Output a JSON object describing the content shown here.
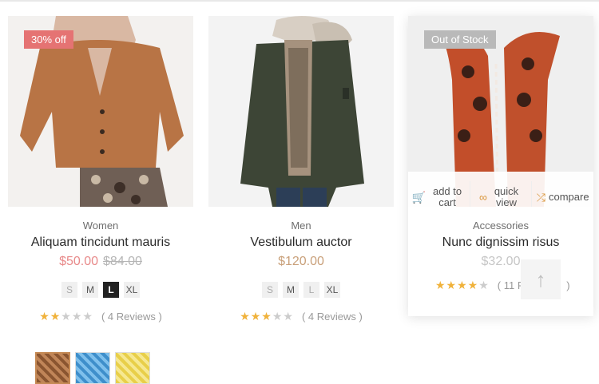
{
  "products": [
    {
      "badge": "30% off",
      "category": "Women",
      "name": "Aliquam tincidunt mauris",
      "price": "$50.00",
      "old_price": "$84.00",
      "sizes": [
        "S",
        "M",
        "L",
        "XL"
      ],
      "selected_size": "L",
      "rating": 2,
      "reviews": "( 4 Reviews )",
      "swatch_colors": [
        "#a66a3e",
        "#5aa7dc",
        "#f2df6a"
      ]
    },
    {
      "category": "Men",
      "name": "Vestibulum auctor",
      "price": "$120.00",
      "sizes": [
        "S",
        "M",
        "L",
        "XL"
      ],
      "rating": 3,
      "reviews": "( 4 Reviews )"
    },
    {
      "badge": "Out of Stock",
      "category": "Accessories",
      "name": "Nunc dignissim risus",
      "price": "$32.00",
      "rating": 4,
      "reviews": "( 11 R",
      "reviews_tail": ")",
      "actions": [
        {
          "label": "add to cart",
          "icon": "cart-icon"
        },
        {
          "label": "quick view",
          "icon": "eye-icon"
        },
        {
          "label": "compare",
          "icon": "shuffle-icon"
        }
      ]
    }
  ],
  "scroll_top_icon": "arrow-up-icon",
  "colors": {
    "accent": "#d9963b",
    "sale": "#e57373",
    "price_sale": "#e88a8a",
    "price": "#c9a07a",
    "star": "#f0b23b"
  }
}
